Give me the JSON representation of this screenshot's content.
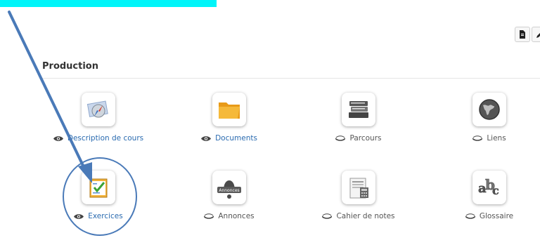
{
  "section": {
    "title": "Production"
  },
  "tools": [
    {
      "label": "Description de cours",
      "icon": "course-description-icon",
      "visible": true
    },
    {
      "label": "Documents",
      "icon": "folder-icon",
      "visible": true
    },
    {
      "label": "Parcours",
      "icon": "books-icon",
      "visible": false
    },
    {
      "label": "Liens",
      "icon": "globe-icon",
      "visible": false
    },
    {
      "label": "Exercices",
      "icon": "exercise-checklist-icon",
      "visible": true
    },
    {
      "label": "Annonces",
      "icon": "bell-icon",
      "visible": false,
      "badge": "Annonces"
    },
    {
      "label": "Cahier de notes",
      "icon": "gradebook-icon",
      "visible": false
    },
    {
      "label": "Glossaire",
      "icon": "abc-icon",
      "visible": false
    }
  ],
  "toolbar": {
    "icons": [
      "document-icon",
      "edit-icon"
    ]
  },
  "colors": {
    "highlight": "#00f5f9",
    "arrow": "#4a7ab8",
    "link": "#2a6bb0"
  }
}
